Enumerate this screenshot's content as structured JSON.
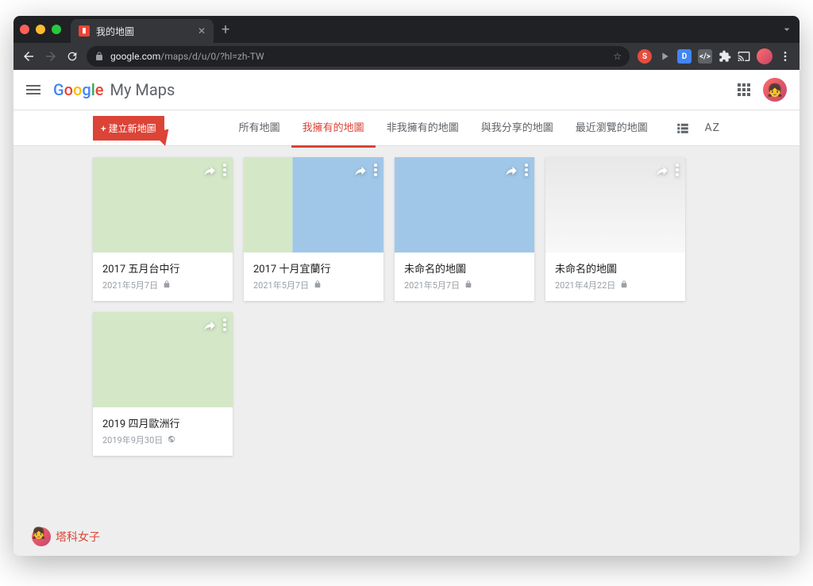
{
  "browser": {
    "tab_title": "我的地圖",
    "url_prefix": "google.com",
    "url_path": "/maps/d/u/0/?hl=zh-TW"
  },
  "header": {
    "logo_text": "Google",
    "product_name": "My Maps"
  },
  "toolbar": {
    "create_label": "+ 建立新地圖",
    "tabs": [
      {
        "label": "所有地圖",
        "active": false
      },
      {
        "label": "我擁有的地圖",
        "active": true
      },
      {
        "label": "非我擁有的地圖",
        "active": false
      },
      {
        "label": "與我分享的地圖",
        "active": false
      },
      {
        "label": "最近瀏覽的地圖",
        "active": false
      }
    ],
    "sort_label": "AZ"
  },
  "maps": [
    {
      "title": "2017 五月台中行",
      "date": "2021年5月7日",
      "privacy": "lock",
      "thumb": "land"
    },
    {
      "title": "2017 十月宜蘭行",
      "date": "2021年5月7日",
      "privacy": "lock",
      "thumb": "water"
    },
    {
      "title": "未命名的地圖",
      "date": "2021年5月7日",
      "privacy": "lock",
      "thumb": "sea"
    },
    {
      "title": "未命名的地圖",
      "date": "2021年4月22日",
      "privacy": "lock",
      "thumb": "blank"
    },
    {
      "title": "2019 四月歐洲行",
      "date": "2019年9月30日",
      "privacy": "public",
      "thumb": "land"
    }
  ],
  "watermark": {
    "text": "塔科女子"
  }
}
